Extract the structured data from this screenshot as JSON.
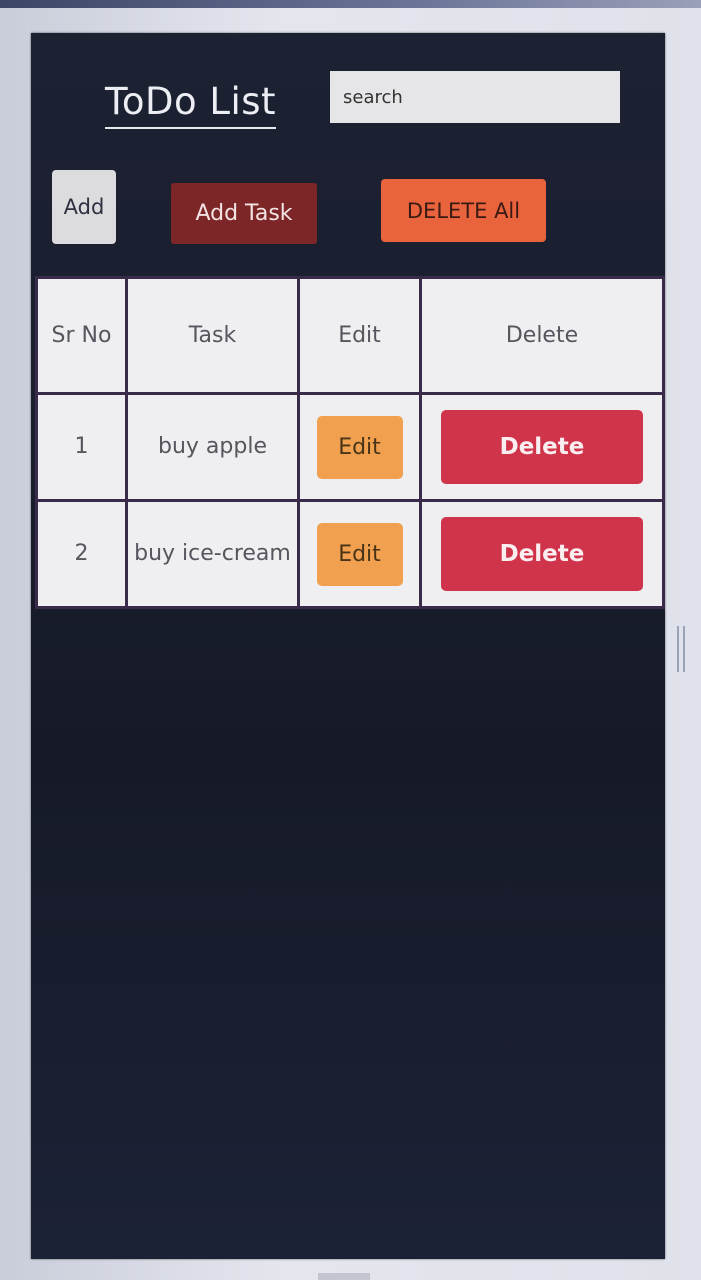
{
  "header": {
    "title": "ToDo List",
    "search": {
      "placeholder": "search",
      "value": ""
    }
  },
  "toolbar": {
    "add_label": "Add",
    "add_task_label": "Add Task",
    "delete_all_label": "DELETE All"
  },
  "table": {
    "columns": {
      "sr_no": "Sr No",
      "task": "Task",
      "edit": "Edit",
      "delete": "Delete"
    },
    "rows": [
      {
        "sr": "1",
        "task": "buy apple",
        "edit_label": "Edit",
        "delete_label": "Delete"
      },
      {
        "sr": "2",
        "task": "buy ice-cream",
        "edit_label": "Edit",
        "delete_label": "Delete"
      }
    ]
  },
  "colors": {
    "panel_bg": "#1d2233",
    "add_task_button": "#7c2627",
    "delete_all_button": "#e9643c",
    "edit_button": "#f0a04e",
    "delete_button": "#cf344b"
  }
}
